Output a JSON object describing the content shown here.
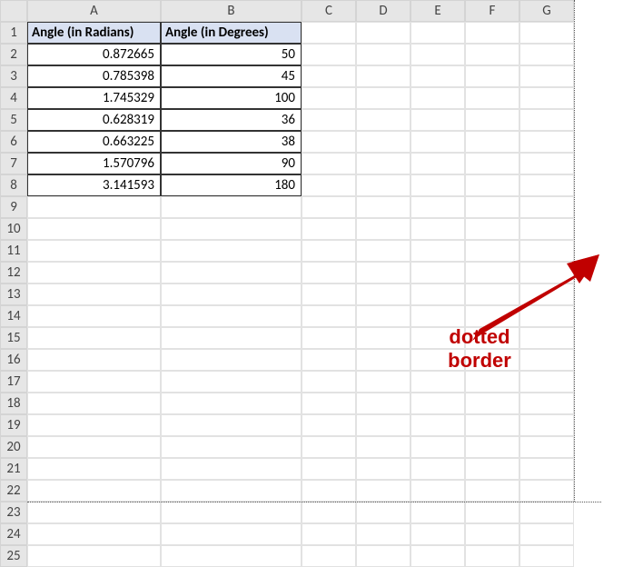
{
  "columns": [
    "A",
    "B",
    "C",
    "D",
    "E",
    "F",
    "G"
  ],
  "row_count": 25,
  "headers": {
    "A": "Angle (in Radians)",
    "B": "Angle (in Degrees)"
  },
  "data_rows": [
    {
      "a": "0.872665",
      "b": "50"
    },
    {
      "a": "0.785398",
      "b": "45"
    },
    {
      "a": "1.745329",
      "b": "100"
    },
    {
      "a": "0.628319",
      "b": "36"
    },
    {
      "a": "0.663225",
      "b": "38"
    },
    {
      "a": "1.570796",
      "b": "90"
    },
    {
      "a": "3.141593",
      "b": "180"
    }
  ],
  "annotation": {
    "line1": "dotted",
    "line2": "border"
  },
  "colors": {
    "header_fill": "#d9e1f2",
    "grid": "#e2e2e2",
    "accent": "#c00000"
  },
  "chart_data": {
    "type": "table",
    "columns": [
      "Angle (in Radians)",
      "Angle (in Degrees)"
    ],
    "rows": [
      [
        0.872665,
        50
      ],
      [
        0.785398,
        45
      ],
      [
        1.745329,
        100
      ],
      [
        0.628319,
        36
      ],
      [
        0.663225,
        38
      ],
      [
        1.570796,
        90
      ],
      [
        3.141593,
        180
      ]
    ]
  }
}
